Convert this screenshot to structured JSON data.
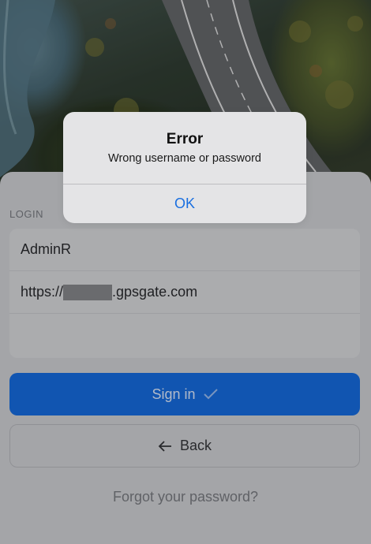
{
  "login": {
    "section_label": "LOGIN",
    "username_value": "AdminR",
    "server_prefix": "https://",
    "server_suffix": ".gpsgate.com",
    "password_value": ""
  },
  "actions": {
    "signin_label": "Sign in",
    "back_label": "Back",
    "forgot_label": "Forgot your password?"
  },
  "alert": {
    "title": "Error",
    "message": "Wrong username or password",
    "ok_label": "OK"
  },
  "colors": {
    "primary": "#0b62d6",
    "alert_button": "#1a6fe0"
  }
}
